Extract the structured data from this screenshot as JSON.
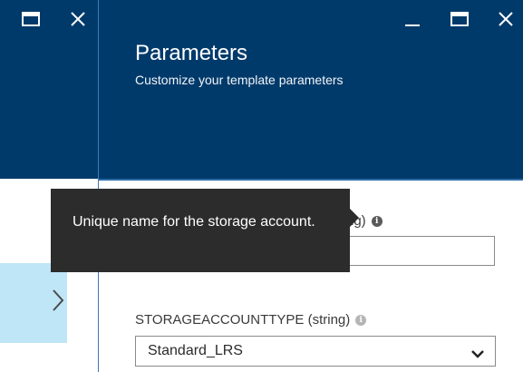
{
  "blade": {
    "title": "Parameters",
    "subtitle": "Customize your template parameters"
  },
  "window_controls": {
    "left": [
      "maximize-icon",
      "close-icon"
    ],
    "right": [
      "minimize-icon",
      "maximize-icon",
      "close-icon"
    ]
  },
  "parameters": [
    {
      "label_visible": "ng)",
      "value": "",
      "tooltip": "Unique name for the storage account."
    },
    {
      "label": "STORAGEACCOUNTTYPE (string)",
      "selected": "Standard_LRS"
    }
  ],
  "colors": {
    "header_bg": "#003a6b",
    "selected_item_bg": "#bfe6f7",
    "tooltip_bg": "#2c2c2c"
  }
}
